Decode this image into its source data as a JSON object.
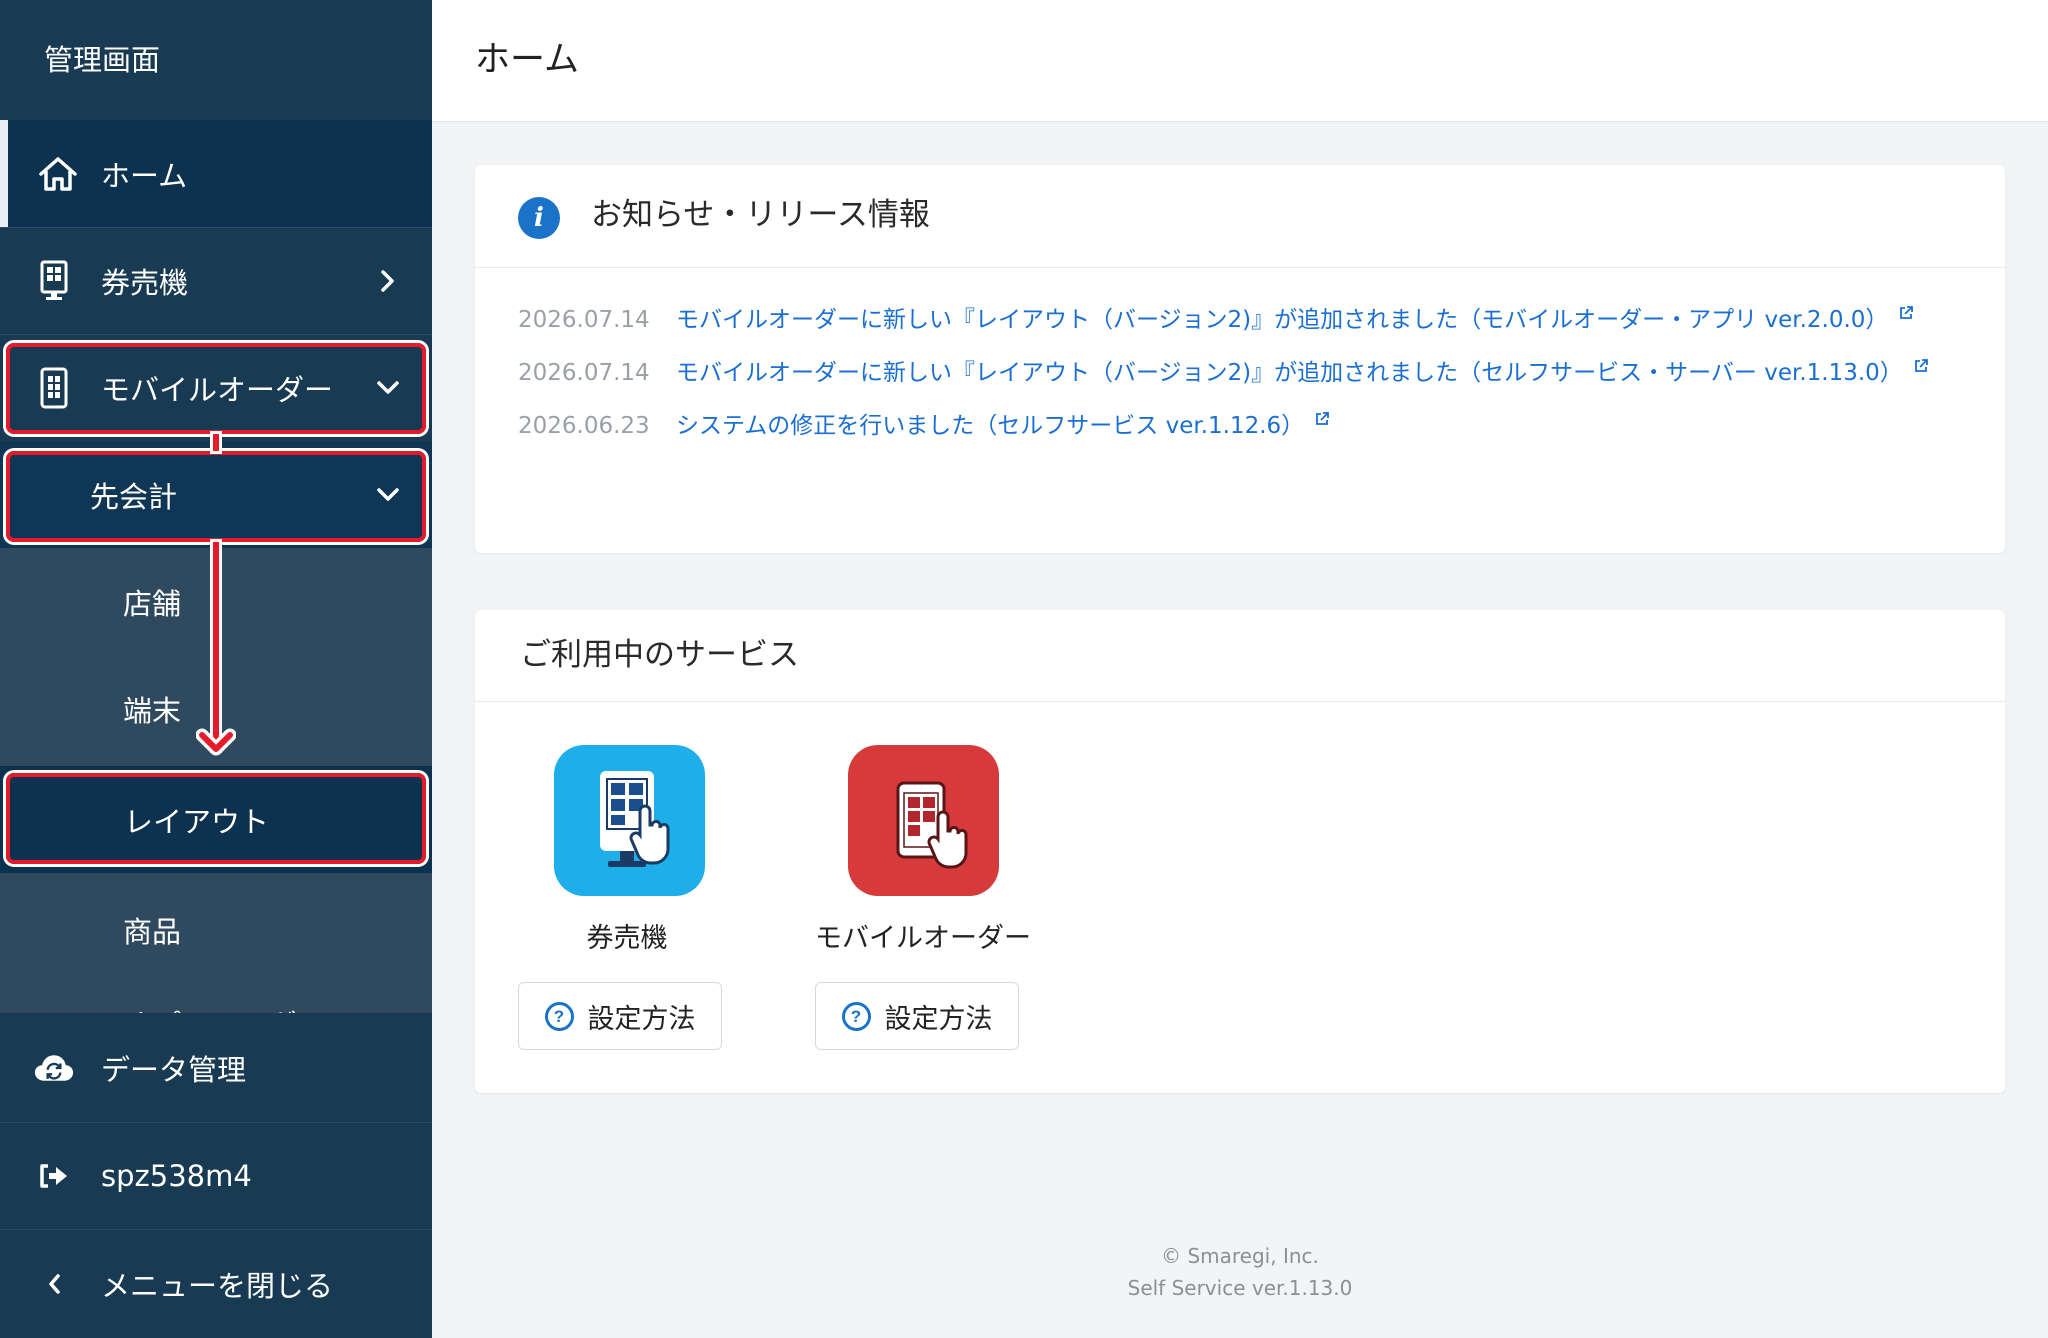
{
  "sidebar": {
    "title": "管理画面",
    "items": {
      "home": "ホーム",
      "ticket": "券売機",
      "mobile": "モバイルオーダー",
      "prepay": "先会計",
      "store": "店舗",
      "terminal": "端末",
      "layout": "レイアウト",
      "product": "商品",
      "option": "オプショングル",
      "data": "データ管理",
      "user": "spz538m4",
      "close": "メニューを閉じる"
    }
  },
  "header": {
    "title": "ホーム"
  },
  "news": {
    "title": "お知らせ・リリース情報",
    "items": [
      {
        "date": "2026.07.14",
        "text": "モバイルオーダーに新しい『レイアウト（バージョン2)』が追加されました（モバイルオーダー・アプリ ver.2.0.0）"
      },
      {
        "date": "2026.07.14",
        "text": "モバイルオーダーに新しい『レイアウト（バージョン2)』が追加されました（セルフサービス・サーバー ver.1.13.0）"
      },
      {
        "date": "2026.06.23",
        "text": "システムの修正を行いました（セルフサービス ver.1.12.6）"
      }
    ]
  },
  "services": {
    "title": "ご利用中のサービス",
    "items": [
      {
        "name": "券売機",
        "help": "設定方法"
      },
      {
        "name": "モバイルオーダー",
        "help": "設定方法"
      }
    ]
  },
  "footer": {
    "copyright": "© Smaregi, Inc.",
    "version": "Self Service ver.1.13.0"
  },
  "colors": {
    "sidebar": "#183a52",
    "sidebar_sub": "#2f4a5f",
    "accent": "#1a73c8",
    "highlight": "#e51b2c",
    "ticket_tile": "#1eaeea",
    "mobile_tile": "#d63a3a"
  }
}
